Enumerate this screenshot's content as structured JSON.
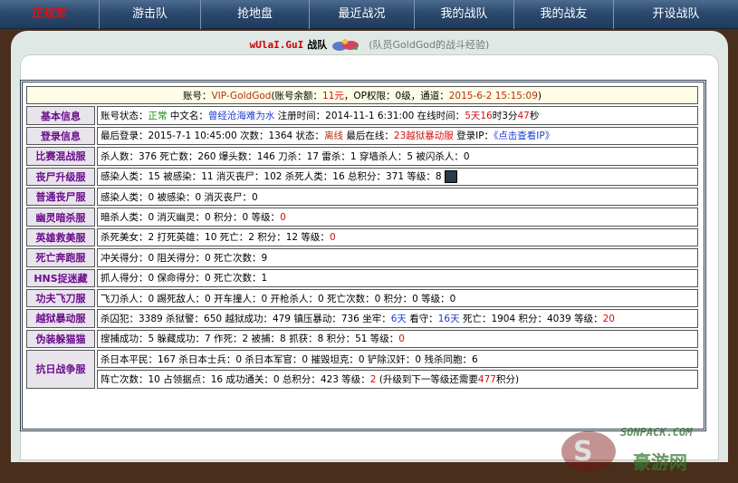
{
  "nav": [
    {
      "label": "正规军",
      "active": true
    },
    {
      "label": "游击队"
    },
    {
      "label": "抢地盘"
    },
    {
      "label": "最近战况"
    },
    {
      "label": "我的战队"
    },
    {
      "label": "我的战友"
    },
    {
      "label": "开设战队"
    }
  ],
  "team": {
    "name": "wUlaI.GuI",
    "suffix": "战队",
    "note": "(队员GoldGod的战斗经验)"
  },
  "account": {
    "label": "账号：",
    "name": "VIP-GoldGod",
    "balance_label": "(账号余额：",
    "balance": "11元",
    "op_label": "，OP权限：",
    "op": "0级",
    "channel_label": "，通道：",
    "channel_time": "2015-6-2 15:15:09",
    "close": ")"
  },
  "rows": [
    {
      "category": "基本信息",
      "segments": [
        {
          "t": "账号状态："
        },
        {
          "t": "正常",
          "c": "g"
        },
        {
          "t": " 中文名："
        },
        {
          "t": "曾经沧海难为水",
          "c": "b"
        },
        {
          "t": " 注册时间：2014-11-1 6:31:00 在线时间："
        },
        {
          "t": "5天",
          "c": "r"
        },
        {
          "t": "16",
          "c": "r"
        },
        {
          "t": "时3分"
        },
        {
          "t": "47",
          "c": "r"
        },
        {
          "t": "秒"
        }
      ]
    },
    {
      "category": "登录信息",
      "segments": [
        {
          "t": "最后登录：2015-7-1 10:45:00 次数：1364 状态："
        },
        {
          "t": "离线",
          "c": "br"
        },
        {
          "t": " 最后在线："
        },
        {
          "t": "23越狱暴动服",
          "c": "r"
        },
        {
          "t": " 登录IP："
        },
        {
          "t": "《点击查看IP》",
          "c": "b"
        }
      ]
    },
    {
      "category": "比赛混战服",
      "segments": [
        {
          "t": "杀人数：376 死亡数：260 爆头数：146 刀杀：17 雷杀：1 穿墙杀人：5 被闪杀人：0"
        }
      ]
    },
    {
      "category": "丧尸升级服",
      "avatar": true,
      "segments": [
        {
          "t": "感染人类：15 被感染：11 消灭丧尸：102 杀死人类：16 总积分：371 等级：8"
        }
      ]
    },
    {
      "category": "普通丧尸服",
      "segments": [
        {
          "t": "感染人类：0 被感染：0 消灭丧尸：0"
        }
      ]
    },
    {
      "category": "幽灵暗杀服",
      "segments": [
        {
          "t": "暗杀人类：0 消灭幽灵：0 积分：0 等级："
        },
        {
          "t": "0",
          "c": "r"
        }
      ]
    },
    {
      "category": "英雄救美服",
      "segments": [
        {
          "t": "杀死美女：2 打死英雄：10 死亡：2 积分：12 等级："
        },
        {
          "t": "0",
          "c": "r"
        }
      ]
    },
    {
      "category": "死亡奔跑服",
      "segments": [
        {
          "t": "冲关得分：0 阻关得分：0 死亡次数：9"
        }
      ]
    },
    {
      "category": "HNS捉迷藏",
      "segments": [
        {
          "t": "抓人得分：0 保命得分：0 死亡次数：1"
        }
      ]
    },
    {
      "category": "功夫飞刀服",
      "segments": [
        {
          "t": "飞刀杀人：0 踢死敌人：0 开车撞人：0 开枪杀人：0 死亡次数：0 积分：0 等级：0"
        }
      ]
    },
    {
      "category": "越狱暴动服",
      "segments": [
        {
          "t": "杀囚犯：3389 杀狱警：650 越狱成功：479 镇压暴动：736 坐牢："
        },
        {
          "t": "6天",
          "c": "b"
        },
        {
          "t": " 看守："
        },
        {
          "t": "16天",
          "c": "b"
        },
        {
          "t": " 死亡：1904 积分：4039 等级："
        },
        {
          "t": "20",
          "c": "r"
        }
      ]
    },
    {
      "category": "伪装躲猫猫",
      "segments": [
        {
          "t": "搜捕成功：5 躲藏成功：7 作死：2 被捕：8 抓获：8 积分：51 等级："
        },
        {
          "t": "0",
          "c": "r"
        }
      ]
    }
  ],
  "war_row": {
    "category": "抗日战争服",
    "line1": [
      {
        "t": "杀日本平民：167 杀日本士兵：0 杀日本军官：0 摧毁坦克：0 铲除汉奸：0 残杀同胞：6"
      }
    ],
    "line2": [
      {
        "t": "阵亡次数：10 占领据点：16 成功通关：0 总积分：423 等级："
      },
      {
        "t": "2",
        "c": "r"
      },
      {
        "t": " (升级到下一等级还需要"
      },
      {
        "t": "477",
        "c": "r"
      },
      {
        "t": "积分)"
      }
    ]
  },
  "watermark": {
    "line1": "SONPACK.COM",
    "line2": "豪游网"
  }
}
